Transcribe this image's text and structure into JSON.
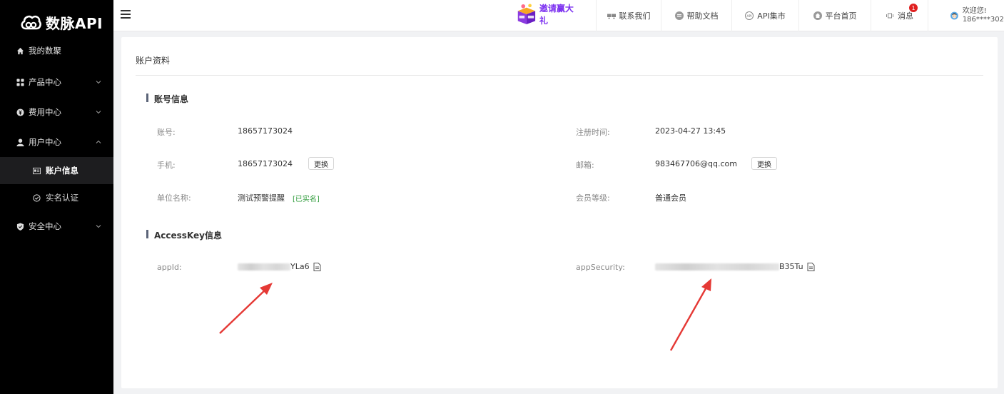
{
  "app": {
    "logo_text": "数脉API"
  },
  "sidebar": {
    "items": [
      {
        "label": "我的数聚"
      },
      {
        "label": "产品中心"
      },
      {
        "label": "费用中心"
      },
      {
        "label": "用户中心"
      },
      {
        "label": "安全中心"
      }
    ],
    "sub_items": [
      {
        "label": "账户信息",
        "active": true
      },
      {
        "label": "实名认证",
        "active": false
      }
    ]
  },
  "header": {
    "promo_label": "邀请赢大礼",
    "nav": [
      {
        "label": "联系我们",
        "icon": "contact-icon"
      },
      {
        "label": "帮助文档",
        "icon": "help-doc-icon"
      },
      {
        "label": "API集市",
        "icon": "api-market-icon"
      },
      {
        "label": "平台首页",
        "icon": "home-icon"
      },
      {
        "label": "消息",
        "icon": "message-icon",
        "badge": "1"
      }
    ],
    "user": {
      "greeting": "欢迎您!",
      "phone": "186****302"
    }
  },
  "page": {
    "title": "账户资料",
    "account_section": {
      "title": "账号信息",
      "account_label": "账号:",
      "account_value": "18657173024",
      "register_label": "注册时间:",
      "register_value": "2023-04-27 13:45",
      "phone_label": "手机:",
      "phone_value": "18657173024",
      "change_label": "更换",
      "email_label": "邮箱:",
      "email_value": "983467706@qq.com",
      "company_label": "单位名称:",
      "company_value": "测试预警提醒",
      "verified_label": "[已实名]",
      "level_label": "会员等级:",
      "level_value": "普通会员"
    },
    "access_section": {
      "title": "AccessKey信息",
      "appid_label": "appId:",
      "appid_visible": "YLa6",
      "appsecurity_label": "appSecurity:",
      "appsecurity_visible": "B35Tu"
    }
  },
  "colors": {
    "sidebar_bg": "#000000",
    "accent_arrow": "#e53935",
    "verified": "#2e9b3a",
    "badge": "#e02020"
  }
}
